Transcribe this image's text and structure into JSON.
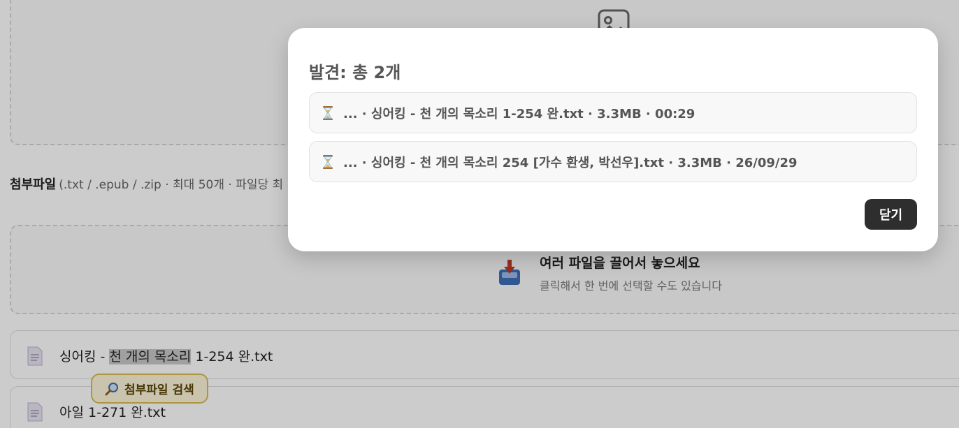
{
  "attachments": {
    "heading": "첨부파일",
    "hint": "(.txt / .epub / .zip · 최대 50개 · 파일당 최"
  },
  "dropzone": {
    "title": "여러 파일을 끌어서 놓으세요",
    "subtitle": "클릭해서 한 번에 선택할 수도 있습니다"
  },
  "files": [
    {
      "prefix": "싱어킹 - ",
      "highlight": "천 개의 목소리",
      "suffix": " 1-254 완.txt"
    },
    {
      "name": "아일 1-271 완.txt"
    }
  ],
  "search_chip": {
    "label": "첨부파일 검색"
  },
  "modal": {
    "title": "발견: 총 2개",
    "results": [
      {
        "icon": "hourglass-icon",
        "text": "... · 싱어킹 - 천 개의 목소리 1-254 완.txt · 3.3MB · 00:29"
      },
      {
        "icon": "hourglass-icon",
        "text": "... · 싱어킹 - 천 개의 목소리 254 [가수 환생, 박선우].txt · 3.3MB · 26/09/29"
      }
    ],
    "close_label": "닫기"
  },
  "colors": {
    "accent_dark": "#2e2e2e",
    "chip_bg": "#fdf6da",
    "chip_border": "#d9bb52",
    "overlay": "rgba(0,0,0,0.2)"
  }
}
